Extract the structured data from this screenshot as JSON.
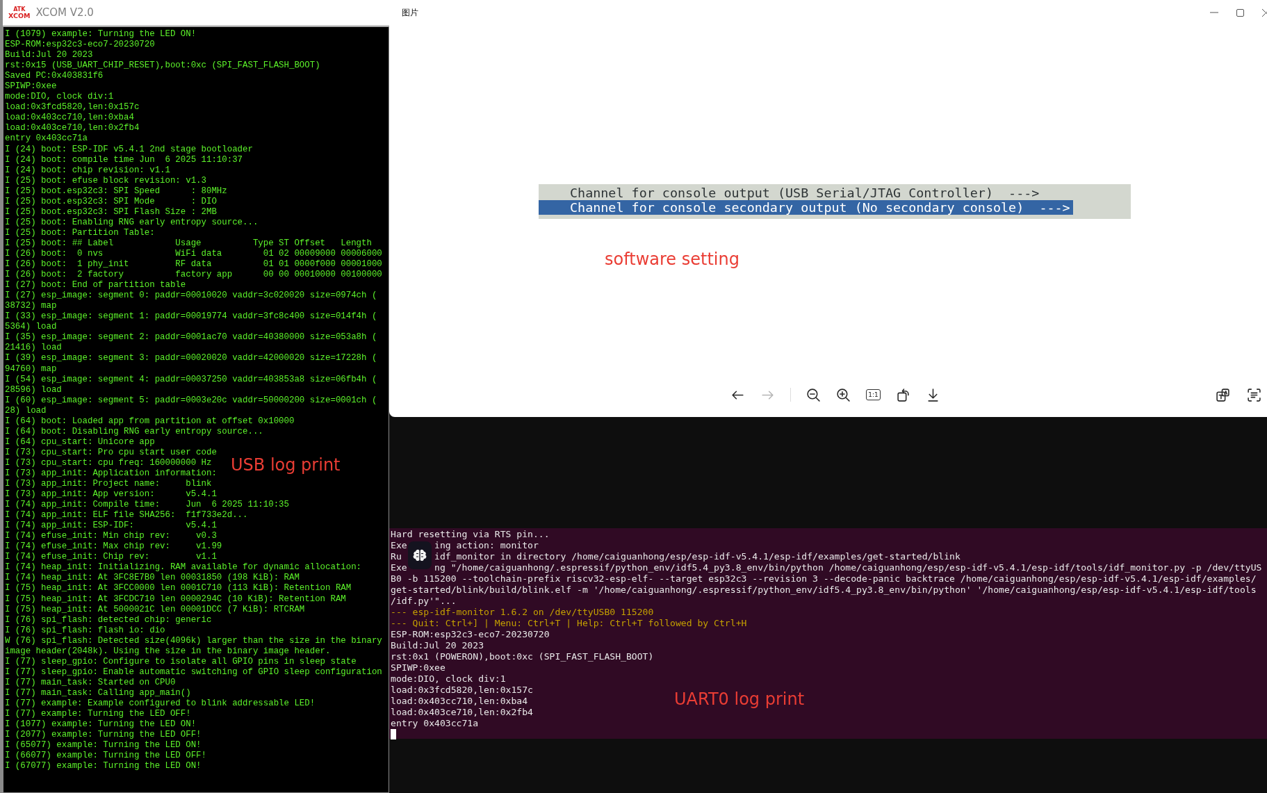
{
  "xcom": {
    "logo": {
      "top": "ATK",
      "bottom": "XCOM"
    },
    "title": "XCOM V2.0",
    "log_lines": [
      "I (1079) example: Turning the LED ON!",
      "ESP-ROM:esp32c3-eco7-20230720",
      "Build:Jul 20 2023",
      "rst:0x15 (USB_UART_CHIP_RESET),boot:0xc (SPI_FAST_FLASH_BOOT)",
      "Saved PC:0x403831f6",
      "SPIWP:0xee",
      "mode:DIO, clock div:1",
      "load:0x3fcd5820,len:0x157c",
      "load:0x403cc710,len:0xba4",
      "load:0x403ce710,len:0x2fb4",
      "entry 0x403cc71a",
      "I (24) boot: ESP-IDF v5.4.1 2nd stage bootloader",
      "I (24) boot: compile time Jun  6 2025 11:10:37",
      "I (24) boot: chip revision: v1.1",
      "I (25) boot: efuse block revision: v1.3",
      "I (25) boot.esp32c3: SPI Speed      : 80MHz",
      "I (25) boot.esp32c3: SPI Mode       : DIO",
      "I (25) boot.esp32c3: SPI Flash Size : 2MB",
      "I (25) boot: Enabling RNG early entropy source...",
      "I (25) boot: Partition Table:",
      "I (25) boot: ## Label            Usage          Type ST Offset   Length",
      "I (26) boot:  0 nvs              WiFi data        01 02 00009000 00006000",
      "I (26) boot:  1 phy_init         RF data          01 01 0000f000 00001000",
      "I (26) boot:  2 factory          factory app      00 00 00010000 00100000",
      "I (27) boot: End of partition table",
      "I (27) esp_image: segment 0: paddr=00010020 vaddr=3c020020 size=0974ch (",
      "38732) map",
      "I (33) esp_image: segment 1: paddr=00019774 vaddr=3fc8c400 size=014f4h (",
      "5364) load",
      "I (35) esp_image: segment 2: paddr=0001ac70 vaddr=40380000 size=053a8h (",
      "21416) load",
      "I (39) esp_image: segment 3: paddr=00020020 vaddr=42000020 size=17228h (",
      "94760) map",
      "I (54) esp_image: segment 4: paddr=00037250 vaddr=403853a8 size=06fb4h (",
      "28596) load",
      "I (60) esp_image: segment 5: paddr=0003e20c vaddr=50000200 size=0001ch (",
      "28) load",
      "I (64) boot: Loaded app from partition at offset 0x10000",
      "I (64) boot: Disabling RNG early entropy source...",
      "I (64) cpu_start: Unicore app",
      "I (73) cpu_start: Pro cpu start user code",
      "I (73) cpu_start: cpu freq: 160000000 Hz",
      "I (73) app_init: Application information:",
      "I (73) app_init: Project name:     blink",
      "I (73) app_init: App version:      v5.4.1",
      "I (74) app_init: Compile time:     Jun  6 2025 11:10:35",
      "I (74) app_init: ELF file SHA256:  f1f733e2d...",
      "I (74) app_init: ESP-IDF:          v5.4.1",
      "I (74) efuse_init: Min chip rev:     v0.3",
      "I (74) efuse_init: Max chip rev:     v1.99",
      "I (74) efuse_init: Chip rev:         v1.1",
      "I (74) heap_init: Initializing. RAM available for dynamic allocation:",
      "I (74) heap_init: At 3FC8E7B0 len 00031850 (198 KiB): RAM",
      "I (75) heap_init: At 3FCC0000 len 0001C710 (113 KiB): Retention RAM",
      "I (75) heap_init: At 3FCDC710 len 0000294C (10 KiB): Retention RAM",
      "I (75) heap_init: At 5000021C len 00001DCC (7 KiB): RTCRAM",
      "I (76) spi_flash: detected chip: generic",
      "I (76) spi_flash: flash io: dio",
      "W (76) spi_flash: Detected size(4096k) larger than the size in the binary",
      "image header(2048k). Using the size in the binary image header.",
      "I (77) sleep_gpio: Configure to isolate all GPIO pins in sleep state",
      "I (77) sleep_gpio: Enable automatic switching of GPIO sleep configuration",
      "I (77) main_task: Started on CPU0",
      "I (77) main_task: Calling app_main()",
      "I (77) example: Example configured to blink addressable LED!",
      "I (77) example: Turning the LED OFF!",
      "I (1077) example: Turning the LED ON!",
      "I (2077) example: Turning the LED OFF!",
      "I (65077) example: Turning the LED ON!",
      "I (66077) example: Turning the LED OFF!",
      "I (67077) example: Turning the LED ON!"
    ],
    "annotation": "USB log print"
  },
  "viewer": {
    "title": "图片",
    "menu": [
      {
        "text": "Channel for console output (USB Serial/JTAG Controller)  --->",
        "selected": false
      },
      {
        "text": "Channel for console secondary output (No secondary console)  --->",
        "selected": true
      }
    ],
    "annotation": "software setting",
    "toolbar_groups": [
      [
        {
          "kind": "back",
          "disabled": false
        },
        {
          "kind": "forward",
          "disabled": true
        }
      ],
      [
        {
          "kind": "zoom-out",
          "disabled": false
        },
        {
          "kind": "zoom-in",
          "disabled": false
        },
        {
          "kind": "actual-size",
          "label": "1:1",
          "disabled": false
        },
        {
          "kind": "rotate",
          "disabled": false
        },
        {
          "kind": "download",
          "disabled": false
        }
      ]
    ],
    "side_tools": [
      {
        "kind": "translate"
      },
      {
        "kind": "text-scan"
      }
    ]
  },
  "terminal": {
    "lines": [
      {
        "kind": "output",
        "parts": [
          "Hard resetting via RTS pin..."
        ]
      },
      {
        "kind": "output",
        "parts": [
          "Exe",
          "ing action: monitor"
        ]
      },
      {
        "kind": "output",
        "parts": [
          "Ru",
          "idf_monitor in directory /home/caiguanhong/esp/esp-idf-v5.4.1/esp-idf/examples/get-started/blink"
        ]
      },
      {
        "kind": "output",
        "parts": [
          "Exe",
          "ng \"/home/caiguanhong/.espressif/python_env/idf5.4_py3.8_env/bin/python /home/caiguanhong/esp/esp-idf-v5.4.1/esp-idf/tools/idf_monitor.py -p /dev/ttyUS"
        ]
      },
      {
        "kind": "output",
        "parts": [
          "B0 -b 115200 --toolchain-prefix riscv32-esp-elf- --target esp32c3 --revision 3 --decode-panic backtrace /home/caiguanhong/esp/esp-idf-v5.4.1/esp-idf/examples/"
        ]
      },
      {
        "kind": "output",
        "parts": [
          "get-started/blink/build/blink.elf -m '/home/caiguanhong/.espressif/python_env/idf5.4_py3.8_env/bin/python' '/home/caiguanhong/esp/esp-idf-v5.4.1/esp-idf/tools"
        ]
      },
      {
        "kind": "output",
        "parts": [
          "/idf.py'\"..."
        ]
      },
      {
        "kind": "monitor",
        "parts": [
          "--- esp-idf-monitor 1.6.2 on /dev/ttyUSB0 115200"
        ]
      },
      {
        "kind": "monitor",
        "parts": [
          "--- Quit: Ctrl+] | Menu: Ctrl+T | Help: Ctrl+T followed by Ctrl+H"
        ]
      },
      {
        "kind": "output",
        "parts": [
          "ESP-ROM:esp32c3-eco7-20230720"
        ]
      },
      {
        "kind": "output",
        "parts": [
          "Build:Jul 20 2023"
        ]
      },
      {
        "kind": "output",
        "parts": [
          "rst:0x1 (POWERON),boot:0xc (SPI_FAST_FLASH_BOOT)"
        ]
      },
      {
        "kind": "output",
        "parts": [
          "SPIWP:0xee"
        ]
      },
      {
        "kind": "output",
        "parts": [
          "mode:DIO, clock div:1"
        ]
      },
      {
        "kind": "output",
        "parts": [
          "load:0x3fcd5820,len:0x157c"
        ]
      },
      {
        "kind": "output",
        "parts": [
          "load:0x403cc710,len:0xba4"
        ]
      },
      {
        "kind": "output",
        "parts": [
          "load:0x403ce710,len:0x2fb4"
        ]
      },
      {
        "kind": "output",
        "parts": [
          "entry 0x403cc71a"
        ]
      }
    ],
    "annotation": "UART0 log print"
  }
}
